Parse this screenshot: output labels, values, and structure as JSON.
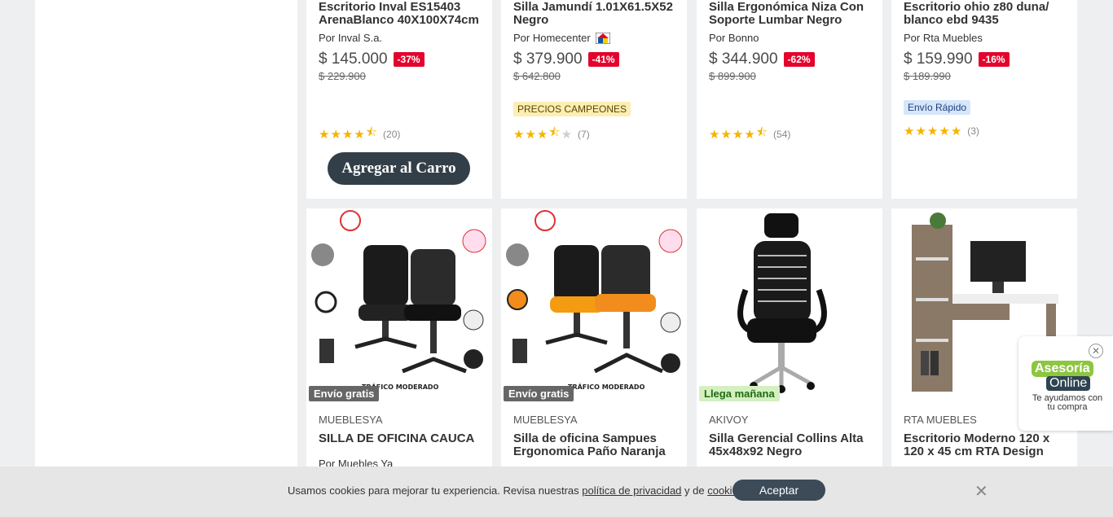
{
  "top_products": [
    {
      "title": "Escritorio Inval ES15403 ArenaBlanco 40X100X74cm",
      "seller": "Por Inval S.a.",
      "price": "$ 145.000",
      "discount": "-37%",
      "old_price": "$ 229.900",
      "rating": 4.5,
      "reviews": "(20)",
      "cart_label": "Agregar al Carro"
    },
    {
      "title": "Silla Jamundí 1.01X61.5X52 Negro",
      "seller": "Por Homecenter",
      "price": "$ 379.900",
      "discount": "-41%",
      "old_price": "$ 642.800",
      "badge": "PRECIOS CAMPEONES",
      "rating": 3.5,
      "reviews": "(7)"
    },
    {
      "title": "Silla Ergonómica Niza Con Soporte Lumbar Negro",
      "seller": "Por Bonno",
      "price": "$ 344.900",
      "discount": "-62%",
      "old_price": "$ 899.900",
      "rating": 4.5,
      "reviews": "(54)"
    },
    {
      "title": "Escritorio ohio z80 duna/ blanco ebd 9435",
      "seller": "Por Rta Muebles",
      "price": "$ 159.990",
      "discount": "-16%",
      "old_price": "$ 189.990",
      "badge": "Envío Rápido",
      "rating": 5,
      "reviews": "(3)"
    }
  ],
  "bottom_products": [
    {
      "ship_badge": "Envío gratis",
      "brand": "MUEBLESYA",
      "title": "SILLA DE OFICINA CAUCA",
      "seller": "Por Muebles Ya"
    },
    {
      "ship_badge": "Envío gratis",
      "brand": "MUEBLESYA",
      "title": "Silla de oficina Sampues Ergonomica Paño Naranja"
    },
    {
      "ship_badge": "Llega mañana",
      "brand": "AKIVOY",
      "title": "Silla Gerencial Collins Alta 45x48x92 Negro"
    },
    {
      "brand": "RTA MUEBLES",
      "title": "Escritorio Moderno 120 x 120 x 45 cm RTA Design"
    }
  ],
  "image_labels": {
    "chair_overlay": "TRÁFICO MODERADO"
  },
  "cookie": {
    "text_before": "Usamos cookies para mejorar tu experiencia. Revisa nuestras ",
    "privacy_link": "política de privacidad",
    "text_mid": " y de ",
    "cookies_link": "cookies",
    "text_after": ".",
    "accept": "Aceptar"
  },
  "chat": {
    "logo_top": "Asesoría",
    "logo_bottom": "Online",
    "subtitle": "Te ayudamos con tu compra"
  },
  "colors": {
    "discount": "#e4032d",
    "cart_button": "#333f48",
    "ship_gray": "#666666",
    "ship_green": "#8cc63f"
  }
}
